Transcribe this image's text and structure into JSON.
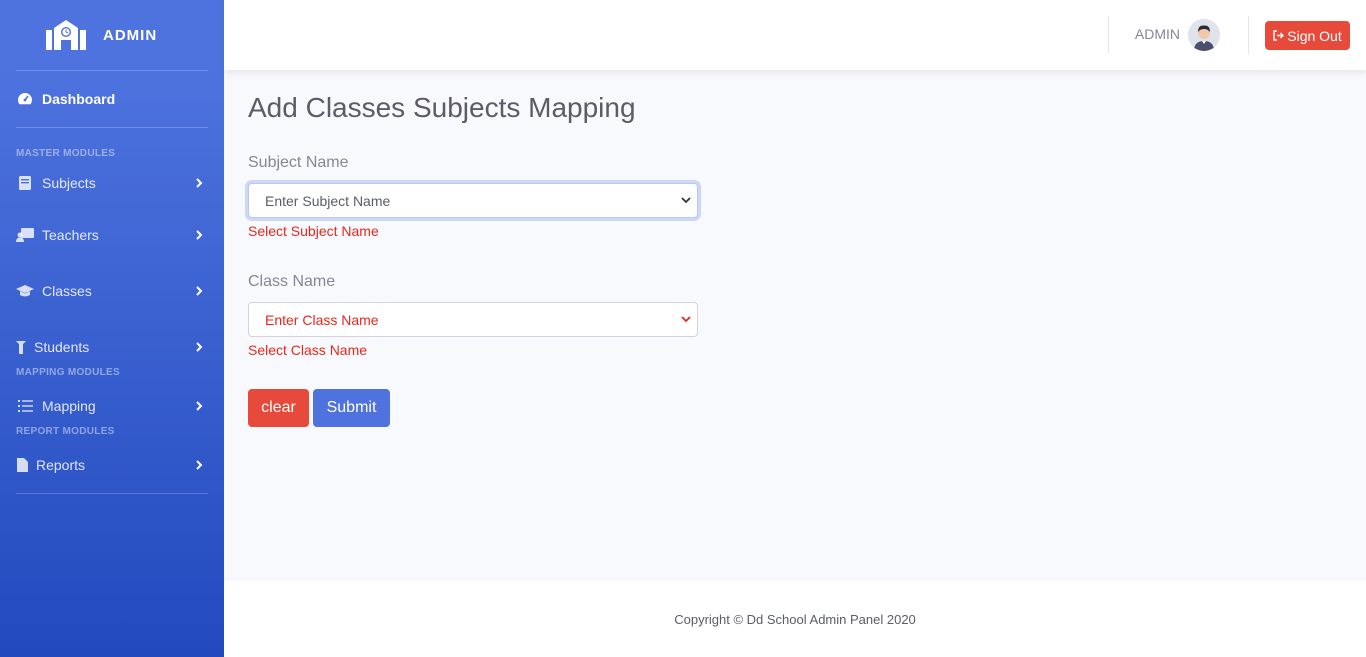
{
  "brand": {
    "name": "ADMIN",
    "icon": "school-icon"
  },
  "sidebar": {
    "dashboard": {
      "label": "Dashboard",
      "icon": "tachometer-icon"
    },
    "headings": {
      "master": "MASTER MODULES",
      "mapping": "MAPPING MODULES",
      "report": "REPORT MODULES"
    },
    "items": [
      {
        "label": "Subjects",
        "icon": "book-icon"
      },
      {
        "label": "Teachers",
        "icon": "chalkboard-teacher-icon"
      },
      {
        "label": "Classes",
        "icon": "graduation-cap-icon"
      },
      {
        "label": "Students",
        "icon": "user-graduate-icon"
      },
      {
        "label": "Mapping",
        "icon": "list-icon"
      },
      {
        "label": "Reports",
        "icon": "file-icon"
      }
    ]
  },
  "topbar": {
    "user": "ADMIN",
    "signout_label": "Sign Out"
  },
  "page": {
    "title": "Add Classes Subjects Mapping",
    "subject": {
      "label": "Subject Name",
      "placeholder": "Enter Subject Name",
      "error": "Select Subject Name"
    },
    "class": {
      "label": "Class Name",
      "placeholder": "Enter Class Name",
      "error": "Select Class Name"
    },
    "clear_label": "clear",
    "submit_label": "Submit"
  },
  "footer": {
    "text": "Copyright © Dd School Admin Panel 2020"
  },
  "colors": {
    "primary": "#4e73df",
    "danger": "#e74a3b",
    "error_text": "#e8271c"
  }
}
